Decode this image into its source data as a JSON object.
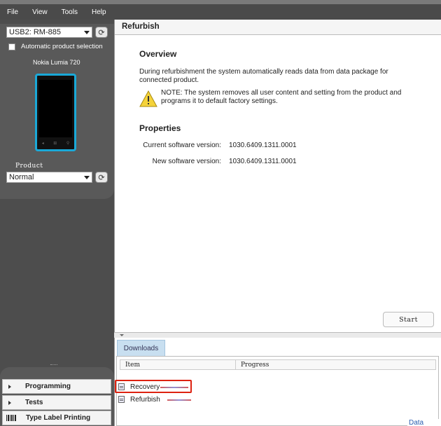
{
  "menu": {
    "items": [
      "File",
      "View",
      "Tools",
      "Help"
    ]
  },
  "sidebar": {
    "connection_select": "USB2: RM-885",
    "auto_select_label": "Automatic product selection",
    "device_name": "Nokia Lumia 720",
    "product_label": "Product",
    "product_select": "Normal",
    "nav": [
      {
        "label": "Programming"
      },
      {
        "label": "Tests"
      },
      {
        "label": "Type Label Printing"
      }
    ]
  },
  "main": {
    "title": "Refurbish",
    "overview_heading": "Overview",
    "overview_text_1": "During refurbishment the system automatically reads data from data package for",
    "overview_text_2": "connected product.",
    "note_1": "NOTE: The system removes all user content and setting from the product and",
    "note_2": "programs it to default factory settings.",
    "properties_heading": "Properties",
    "current_sw_label": "Current software version:",
    "current_sw_value": "1030.6409.1311.0001",
    "new_sw_label": "New software version:",
    "new_sw_value": "1030.6409.1311.0001",
    "start_label": "Start"
  },
  "downloads": {
    "tab_label": "Downloads",
    "col_item": "Item",
    "col_progress": "Progress",
    "rows": [
      {
        "name": "Recovery"
      },
      {
        "name": "Refurbish"
      }
    ]
  },
  "status": {
    "link": "Data pack"
  },
  "colors": {
    "accent": "#1aa9d8",
    "highlight": "#d21111",
    "link": "#2a5db0"
  }
}
